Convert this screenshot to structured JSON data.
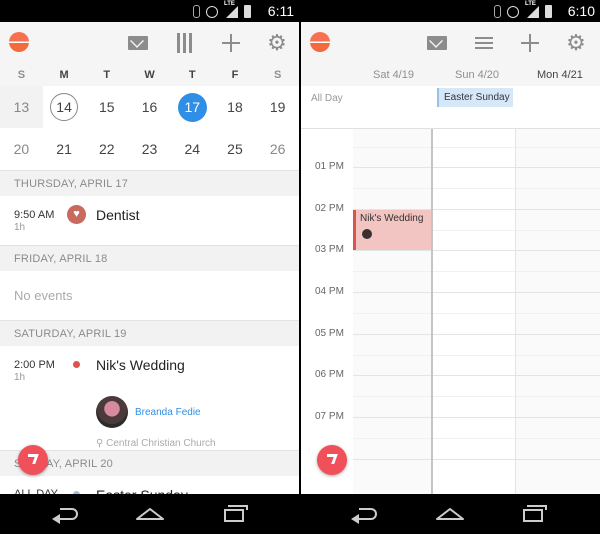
{
  "left": {
    "status": {
      "time": "6:11",
      "network": "LTE"
    },
    "weekday_labels": [
      "S",
      "M",
      "T",
      "W",
      "T",
      "F",
      "S"
    ],
    "week1": [
      "13",
      "14",
      "15",
      "16",
      "17",
      "18",
      "19"
    ],
    "week2": [
      "20",
      "21",
      "22",
      "23",
      "24",
      "25",
      "26"
    ],
    "sections": {
      "thu": "THURSDAY, APRIL 17",
      "fri": "FRIDAY, APRIL 18",
      "sat": "SATURDAY, APRIL 19",
      "sun": "SUNDAY, APRIL 20"
    },
    "dentist": {
      "time": "9:50 AM",
      "duration": "1h",
      "title": "Dentist"
    },
    "no_events": "No events",
    "wedding": {
      "time": "2:00 PM",
      "duration": "1h",
      "title": "Nik's Wedding",
      "attendee": "Breanda Fedie",
      "location": "Central Christian Church"
    },
    "easter": {
      "time": "ALL DAY",
      "title": "Easter Sunday"
    },
    "colors": {
      "today": "#2f8fe6",
      "dentist": "#c96a5f",
      "wedding": "#d9534f",
      "easter": "#94c2e8",
      "fab": "#f0505a"
    }
  },
  "right": {
    "status": {
      "time": "6:10",
      "network": "LTE"
    },
    "day_headers": [
      "Sat 4/19",
      "Sun 4/20",
      "Mon 4/21"
    ],
    "all_day_label": "All Day",
    "easter_chip": "Easter Sunday",
    "hours": [
      "01 PM",
      "02 PM",
      "03 PM",
      "04 PM",
      "05 PM",
      "06 PM",
      "07 PM"
    ],
    "wedding_block": "Nik's Wedding"
  }
}
